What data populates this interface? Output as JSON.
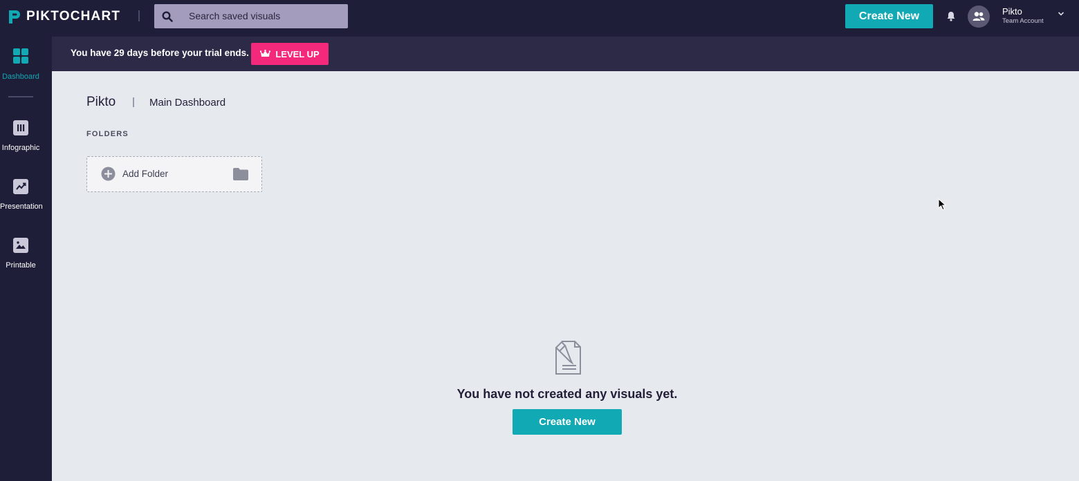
{
  "brand": {
    "name": "PIKTOCHART",
    "accent": "#11a9b4",
    "pink": "#f5297b"
  },
  "header": {
    "search_placeholder": "Search saved visuals",
    "create_label": "Create New",
    "user_name": "Pikto",
    "user_role": "Team Account",
    "icons": [
      "search-icon",
      "bell-icon",
      "avatar-icon",
      "chevron-down-icon"
    ]
  },
  "banner": {
    "text": "You have 29 days before your trial ends.",
    "cta_label": "LEVEL UP",
    "cta_icon": "crown-icon"
  },
  "sidebar": {
    "items": [
      {
        "label": "Dashboard",
        "icon": "dashboard-icon",
        "active": true
      },
      {
        "label": "Infographic",
        "icon": "infographic-icon",
        "active": false
      },
      {
        "label": "Presentation",
        "icon": "presentation-icon",
        "active": false
      },
      {
        "label": "Printable",
        "icon": "printable-icon",
        "active": false
      }
    ]
  },
  "breadcrumb": {
    "team": "Pikto",
    "page": "Main Dashboard"
  },
  "folders": {
    "heading": "FOLDERS",
    "add_label": "Add Folder"
  },
  "empty_state": {
    "message": "You have not created any visuals yet.",
    "cta_label": "Create New",
    "icon": "document-icon"
  }
}
